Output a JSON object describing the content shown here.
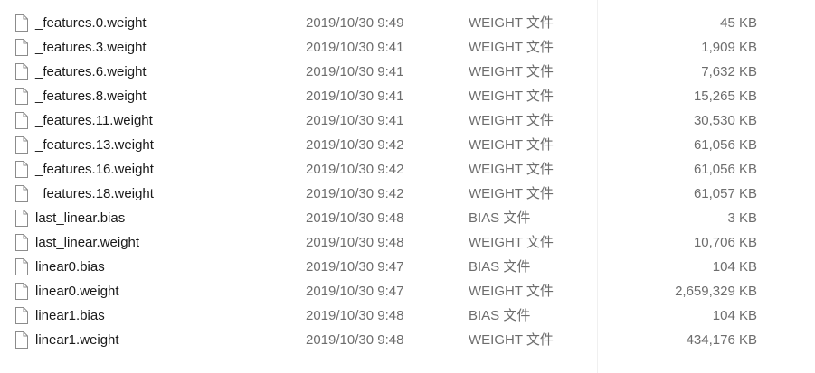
{
  "colors": {
    "name_text": "#1a1a1a",
    "meta_text": "#6d6d6d",
    "icon_stroke": "#8c8c8c",
    "background": "#ffffff"
  },
  "icon_name": "file-icon",
  "files": [
    {
      "name": "_features.0.weight",
      "date": "2019/10/30 9:49",
      "type": "WEIGHT 文件",
      "size": "45 KB"
    },
    {
      "name": "_features.3.weight",
      "date": "2019/10/30 9:41",
      "type": "WEIGHT 文件",
      "size": "1,909 KB"
    },
    {
      "name": "_features.6.weight",
      "date": "2019/10/30 9:41",
      "type": "WEIGHT 文件",
      "size": "7,632 KB"
    },
    {
      "name": "_features.8.weight",
      "date": "2019/10/30 9:41",
      "type": "WEIGHT 文件",
      "size": "15,265 KB"
    },
    {
      "name": "_features.11.weight",
      "date": "2019/10/30 9:41",
      "type": "WEIGHT 文件",
      "size": "30,530 KB"
    },
    {
      "name": "_features.13.weight",
      "date": "2019/10/30 9:42",
      "type": "WEIGHT 文件",
      "size": "61,056 KB"
    },
    {
      "name": "_features.16.weight",
      "date": "2019/10/30 9:42",
      "type": "WEIGHT 文件",
      "size": "61,056 KB"
    },
    {
      "name": "_features.18.weight",
      "date": "2019/10/30 9:42",
      "type": "WEIGHT 文件",
      "size": "61,057 KB"
    },
    {
      "name": "last_linear.bias",
      "date": "2019/10/30 9:48",
      "type": "BIAS 文件",
      "size": "3 KB"
    },
    {
      "name": "last_linear.weight",
      "date": "2019/10/30 9:48",
      "type": "WEIGHT 文件",
      "size": "10,706 KB"
    },
    {
      "name": "linear0.bias",
      "date": "2019/10/30 9:47",
      "type": "BIAS 文件",
      "size": "104 KB"
    },
    {
      "name": "linear0.weight",
      "date": "2019/10/30 9:47",
      "type": "WEIGHT 文件",
      "size": "2,659,329 KB"
    },
    {
      "name": "linear1.bias",
      "date": "2019/10/30 9:48",
      "type": "BIAS 文件",
      "size": "104 KB"
    },
    {
      "name": "linear1.weight",
      "date": "2019/10/30 9:48",
      "type": "WEIGHT 文件",
      "size": "434,176 KB"
    }
  ]
}
